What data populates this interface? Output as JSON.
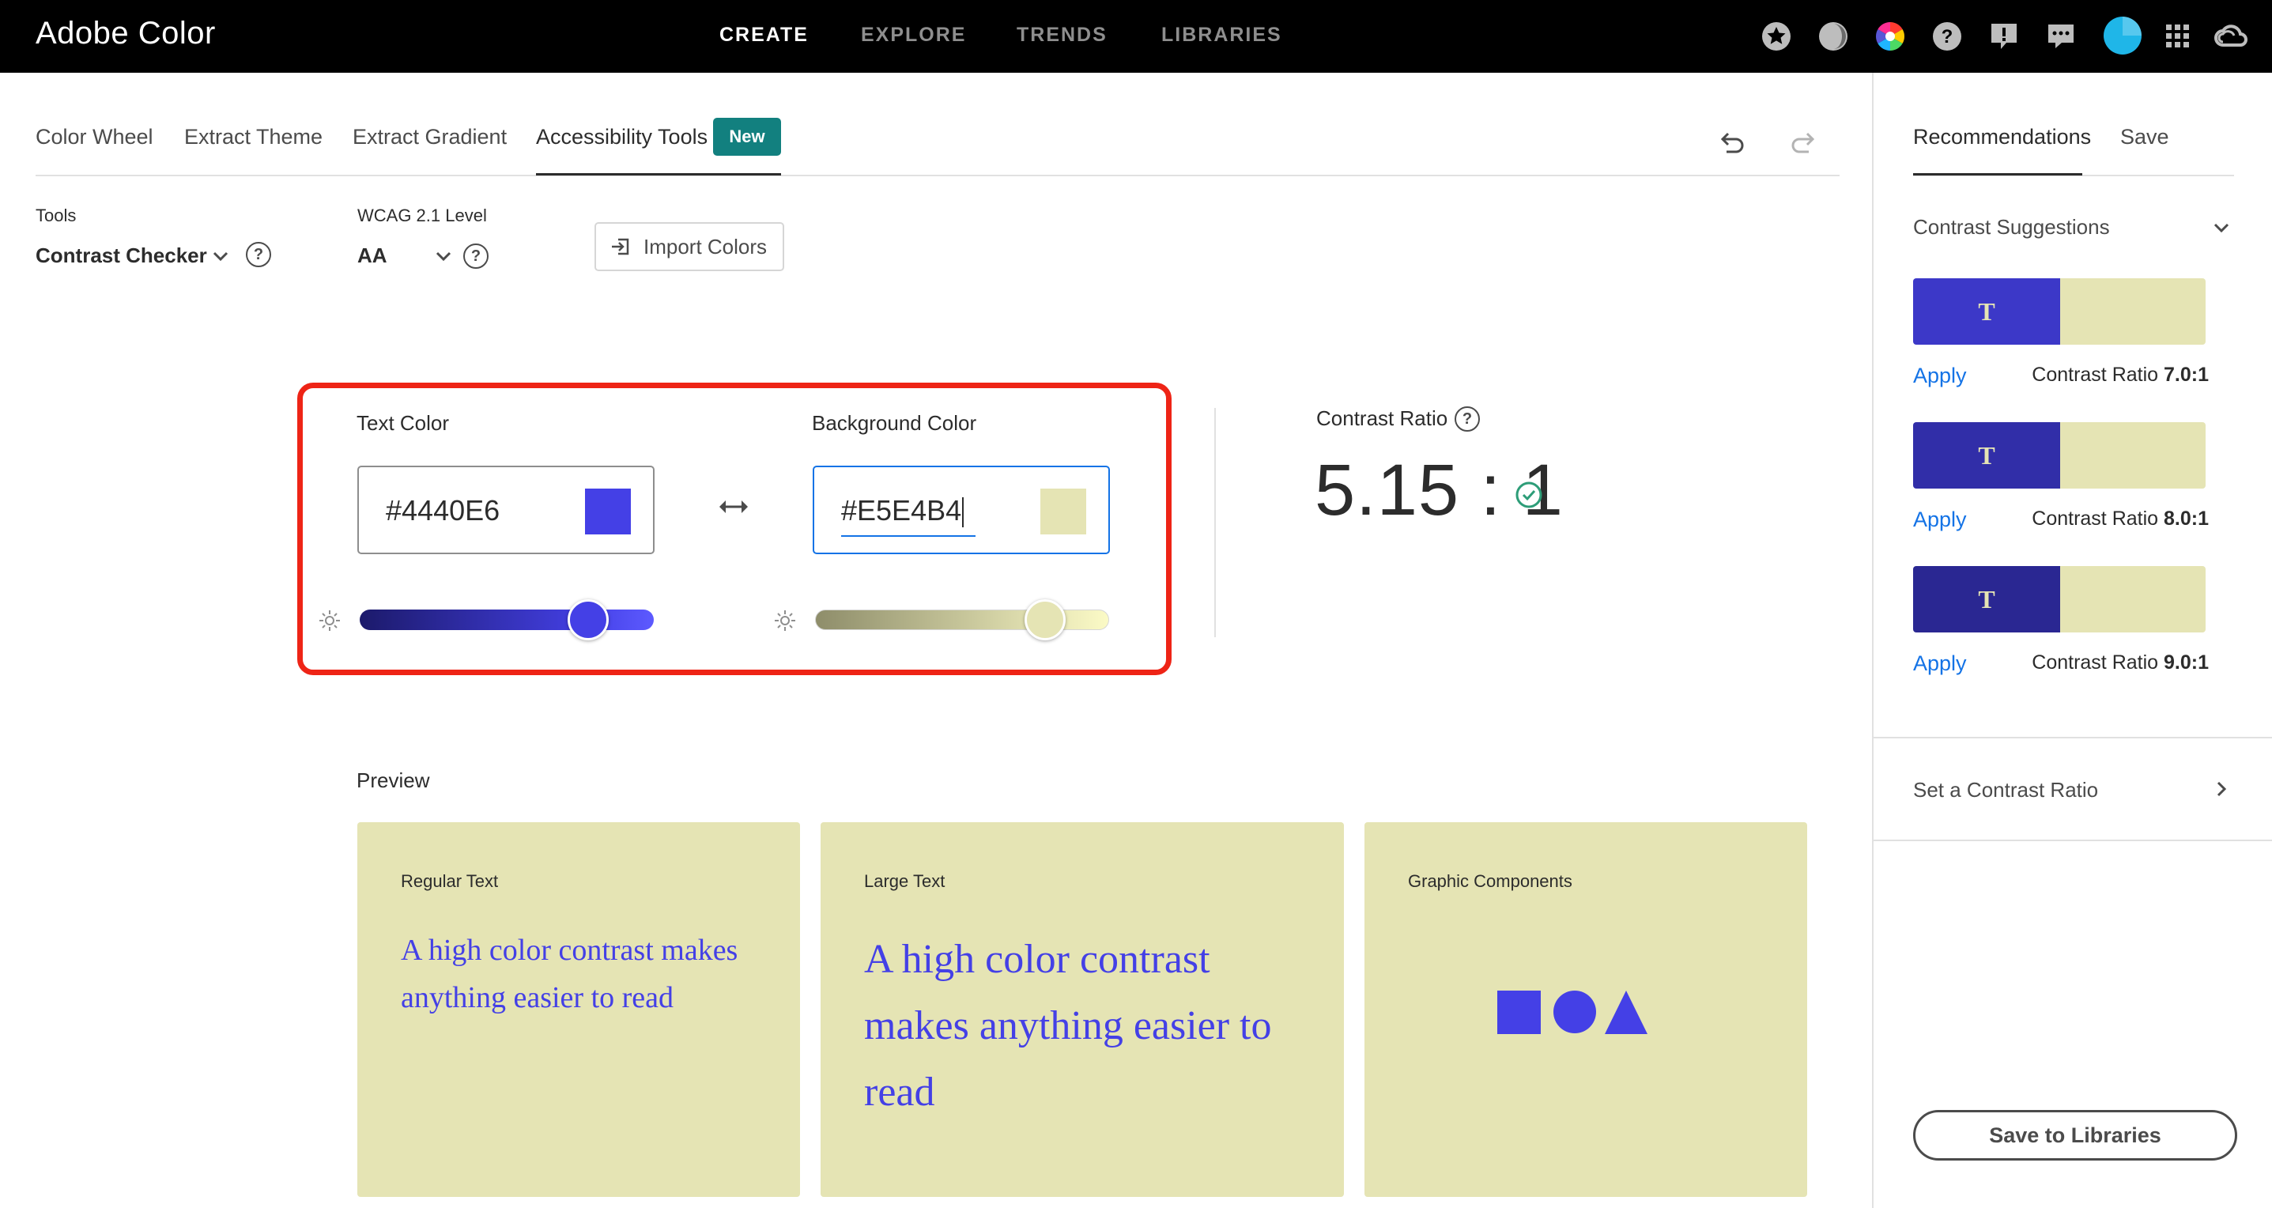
{
  "app": {
    "title": "Adobe Color"
  },
  "topnav": {
    "items": [
      "CREATE",
      "EXPLORE",
      "TRENDS",
      "LIBRARIES"
    ],
    "active": "CREATE"
  },
  "tabs": {
    "items": [
      "Color Wheel",
      "Extract Theme",
      "Extract Gradient",
      "Accessibility Tools"
    ],
    "active": "Accessibility Tools",
    "badge": "New"
  },
  "tools": {
    "tools_label": "Tools",
    "tools_value": "Contrast Checker",
    "wcag_label": "WCAG 2.1 Level",
    "wcag_value": "AA",
    "import_label": "Import Colors",
    "help_glyph": "?"
  },
  "checker": {
    "text_color_label": "Text Color",
    "text_color_value": "#4440E6",
    "background_color_label": "Background Color",
    "background_color_value": "#E5E4B4",
    "text_brightness": 0.82,
    "background_brightness": 0.82,
    "colors": {
      "text": "#4440e6",
      "background": "#e5e4b4",
      "highlight": "#ee2416"
    }
  },
  "contrast": {
    "label": "Contrast Ratio",
    "value": "5.15 : 1",
    "pass": true
  },
  "preview": {
    "label": "Preview",
    "cards": [
      {
        "title": "Regular Text",
        "text": "A high color contrast makes anything easier to read"
      },
      {
        "title": "Large Text",
        "text": "A high color contrast makes anything easier to read"
      },
      {
        "title": "Graphic Components",
        "shapes": [
          "square",
          "circle",
          "triangle"
        ]
      }
    ]
  },
  "right_panel": {
    "tabs": [
      "Recommendations",
      "Save"
    ],
    "active_tab": "Recommendations",
    "suggestions_header": "Contrast Suggestions",
    "swatch_glyph": "T",
    "suggestions": [
      {
        "apply": "Apply",
        "ratio_prefix": "Contrast Ratio ",
        "ratio": "7.0:1",
        "text_color": "#3c38c8"
      },
      {
        "apply": "Apply",
        "ratio_prefix": "Contrast Ratio ",
        "ratio": "8.0:1",
        "text_color": "#312ea8"
      },
      {
        "apply": "Apply",
        "ratio_prefix": "Contrast Ratio ",
        "ratio": "9.0:1",
        "text_color": "#2a2792"
      }
    ],
    "set_ratio_label": "Set a Contrast Ratio",
    "save_button": "Save to Libraries"
  },
  "icons": {
    "top": [
      "star-icon",
      "moon-icon",
      "color-wheel-icon",
      "help-icon",
      "alert-icon",
      "chat-icon",
      "avatar-icon",
      "apps-grid-icon",
      "creative-cloud-icon"
    ],
    "history": [
      "undo-icon",
      "redo-icon"
    ]
  }
}
